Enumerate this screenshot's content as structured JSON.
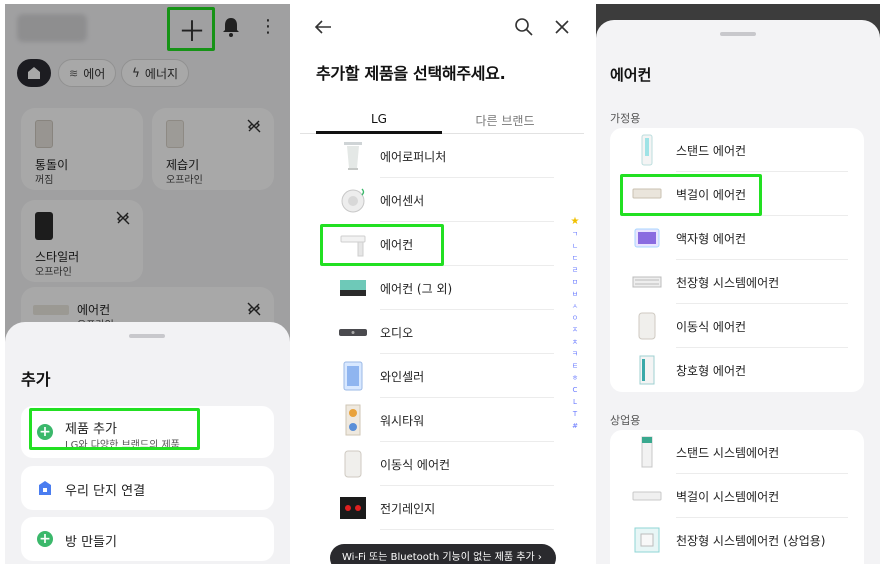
{
  "panel1": {
    "header": {
      "add_icon": "plus-icon",
      "bell_icon": "bell-icon",
      "more_icon": "more-vertical-icon"
    },
    "filters": [
      {
        "icon": "home-icon",
        "label": ""
      },
      {
        "icon": "aircon-icon",
        "label": "에어"
      },
      {
        "icon": "bolt-icon",
        "label": "에너지"
      }
    ],
    "devices": [
      {
        "name": "통돌이",
        "status": "꺼짐"
      },
      {
        "name": "제습기",
        "status": "오프라인"
      },
      {
        "name": "스타일러",
        "status": "오프라인"
      },
      {
        "name": "에어컨",
        "status": "오프라인"
      }
    ],
    "sheet": {
      "title": "추가",
      "options": [
        {
          "label": "제품 추가",
          "sub": "LG와 다양한 브랜드의 제품"
        },
        {
          "label": "우리 단지 연결",
          "sub": ""
        },
        {
          "label": "방 만들기",
          "sub": ""
        }
      ]
    },
    "colors": {
      "highlight": "#22e022",
      "accent_green": "#3bb86b"
    }
  },
  "panel2": {
    "title": "추가할 제품을 선택해주세요.",
    "tabs": [
      "LG",
      "다른 브랜드"
    ],
    "products": [
      "에어로퍼니처",
      "에어센서",
      "에어컨",
      "에어컨 (그 외)",
      "오디오",
      "와인셀러",
      "워시타워",
      "이동식 에어컨",
      "전기레인지"
    ],
    "index": [
      "★",
      "ㄱ",
      "ㄴ",
      "ㄷ",
      "ㄹ",
      "ㅁ",
      "ㅂ",
      "ㅅ",
      "ㅇ",
      "ㅈ",
      "ㅊ",
      "ㅋ",
      "ㅌ",
      "ㅎ",
      "C",
      "L",
      "T",
      "#"
    ],
    "toast": "Wi-Fi 또는 Bluetooth 기능이 없는 제품 추가  ›"
  },
  "panel3": {
    "title": "에어컨",
    "sections": [
      {
        "label": "가정용",
        "items": [
          "스탠드 에어컨",
          "벽걸이 에어컨",
          "액자형 에어컨",
          "천장형 시스템에어컨",
          "이동식 에어컨",
          "창호형 에어컨"
        ]
      },
      {
        "label": "상업용",
        "items": [
          "스탠드 시스템에어컨",
          "벽걸이 시스템에어컨",
          "천장형 시스템에어컨 (상업용)"
        ]
      }
    ]
  }
}
